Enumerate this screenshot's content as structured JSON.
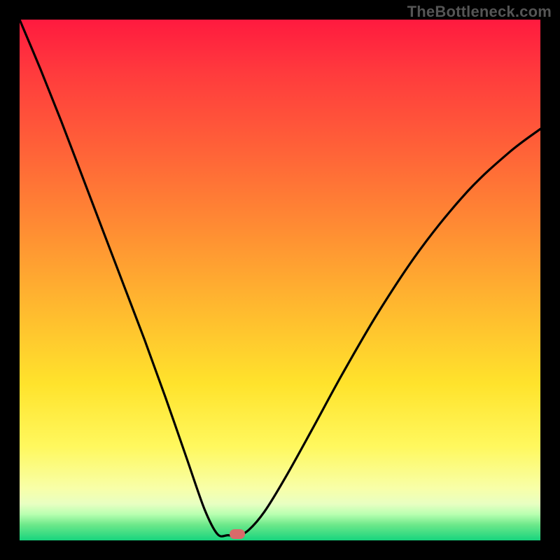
{
  "watermark": "TheBottleneck.com",
  "colors": {
    "curve_stroke": "#000000",
    "marker_fill": "#d96a6a",
    "frame": "#000000"
  },
  "marker": {
    "x_frac": 0.418,
    "y_frac": 0.988
  },
  "chart_data": {
    "type": "line",
    "title": "",
    "xlabel": "",
    "ylabel": "",
    "xlim": [
      0,
      1
    ],
    "ylim": [
      0,
      1
    ],
    "note": "Axes are unlabeled in the source image; x and y expressed as 0–1 fractions of the plot area (y=0 at bottom). Curve resembles a bottleneck V-shape: steep descent from top-left, flat minimum near x≈0.38–0.42, then concave rise toward upper-right.",
    "series": [
      {
        "name": "bottleneck-curve",
        "x": [
          0.0,
          0.04,
          0.08,
          0.12,
          0.16,
          0.2,
          0.24,
          0.28,
          0.32,
          0.355,
          0.38,
          0.4,
          0.42,
          0.44,
          0.47,
          0.51,
          0.56,
          0.62,
          0.69,
          0.77,
          0.86,
          0.94,
          1.0
        ],
        "y": [
          1.0,
          0.905,
          0.805,
          0.7,
          0.595,
          0.49,
          0.385,
          0.275,
          0.16,
          0.06,
          0.012,
          0.01,
          0.01,
          0.02,
          0.055,
          0.12,
          0.21,
          0.32,
          0.44,
          0.56,
          0.67,
          0.745,
          0.79
        ]
      }
    ],
    "annotations": [
      {
        "name": "minimum-marker",
        "x": 0.418,
        "y": 0.012,
        "shape": "pill",
        "color": "#d96a6a"
      }
    ]
  }
}
